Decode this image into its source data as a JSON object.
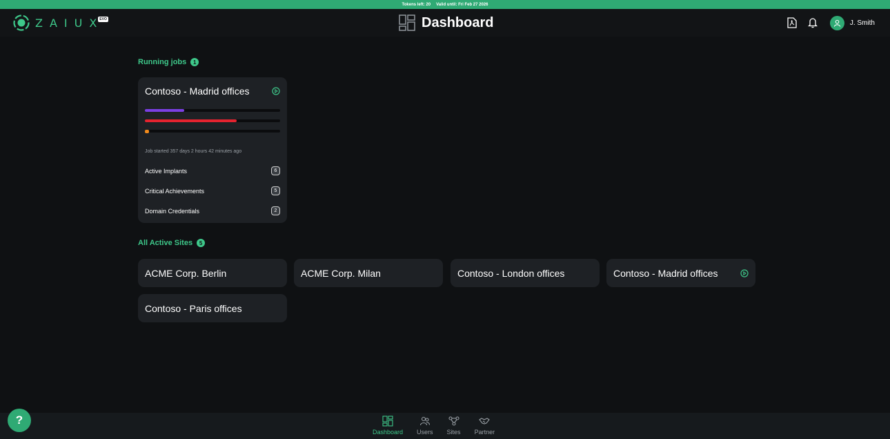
{
  "banner": {
    "tokens_text": "Tokens left: 20",
    "valid_text": "Valid until: Fri Feb 27 2026"
  },
  "header": {
    "logo_text": "ZAIUX",
    "logo_badge": "EVO",
    "page_title": "Dashboard",
    "username": "J. Smith",
    "icons": [
      "pdf-report-icon",
      "bell-icon",
      "user-avatar-icon"
    ]
  },
  "running_jobs": {
    "title": "Running jobs",
    "count": "1",
    "jobs": [
      {
        "name": "Contoso - Madrid offices",
        "progress": [
          {
            "color": "#7b3fe4",
            "fraction": 0.29
          },
          {
            "color": "#e5232f",
            "fraction": 0.68
          },
          {
            "color": "#f08a1c",
            "fraction": 0.03
          }
        ],
        "started": "Job started 357 days 2 hours 42 minutes ago",
        "stats": [
          {
            "label": "Active Implants",
            "value": "6"
          },
          {
            "label": "Critical Achievements",
            "value": "5"
          },
          {
            "label": "Domain Credentials",
            "value": "2"
          }
        ]
      }
    ]
  },
  "active_sites": {
    "title": "All Active Sites",
    "count": "5",
    "sites": [
      {
        "name": "ACME Corp. Berlin",
        "running": false
      },
      {
        "name": "ACME Corp. Milan",
        "running": false
      },
      {
        "name": "Contoso - London offices",
        "running": false
      },
      {
        "name": "Contoso - Madrid offices",
        "running": true
      },
      {
        "name": "Contoso - Paris offices",
        "running": false
      }
    ]
  },
  "help": {
    "label": "?"
  },
  "nav": {
    "items": [
      {
        "label": "Dashboard",
        "icon": "dashboard-icon",
        "active": true
      },
      {
        "label": "Users",
        "icon": "users-icon",
        "active": false
      },
      {
        "label": "Sites",
        "icon": "sites-icon",
        "active": false
      },
      {
        "label": "Partner",
        "icon": "handshake-icon",
        "active": false
      }
    ]
  },
  "colors": {
    "accent": "#3ec88a",
    "background": "#0f1113",
    "card": "#1e2125"
  }
}
